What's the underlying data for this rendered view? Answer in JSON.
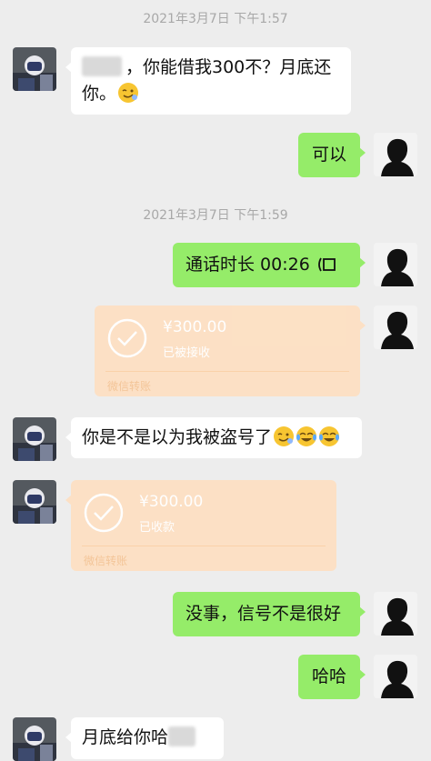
{
  "messages": {
    "ts1": "2021年3月7日 下午1:57",
    "msg1_text": "，你能借我300不？月底还你。",
    "msg2_text": "可以",
    "ts2": "2021年3月7日 下午1:59",
    "call_label": "通话时长 00:26",
    "transfer1": {
      "amount": "¥300.00",
      "status": "已被接收",
      "footer": "微信转账"
    },
    "msg3_text": "你是不是以为我被盗号了",
    "transfer2": {
      "amount": "¥300.00",
      "status": "已收款",
      "footer": "微信转账"
    },
    "msg4_text": "没事，信号不是很好",
    "msg5_text": "哈哈",
    "msg6_text": "月底给你哈"
  },
  "colors": {
    "background": "#ededed",
    "outgoing_bubble": "#95ec69",
    "incoming_bubble": "#ffffff",
    "transfer_card": "#fde0c3",
    "timestamp": "#a8a8a8"
  },
  "icons": {
    "emoji": "smirk-emoji",
    "cry_laugh": "tears-of-joy-emoji",
    "voice_call": "voice-call-icon",
    "transfer_received": "checkmark-circle-icon"
  }
}
